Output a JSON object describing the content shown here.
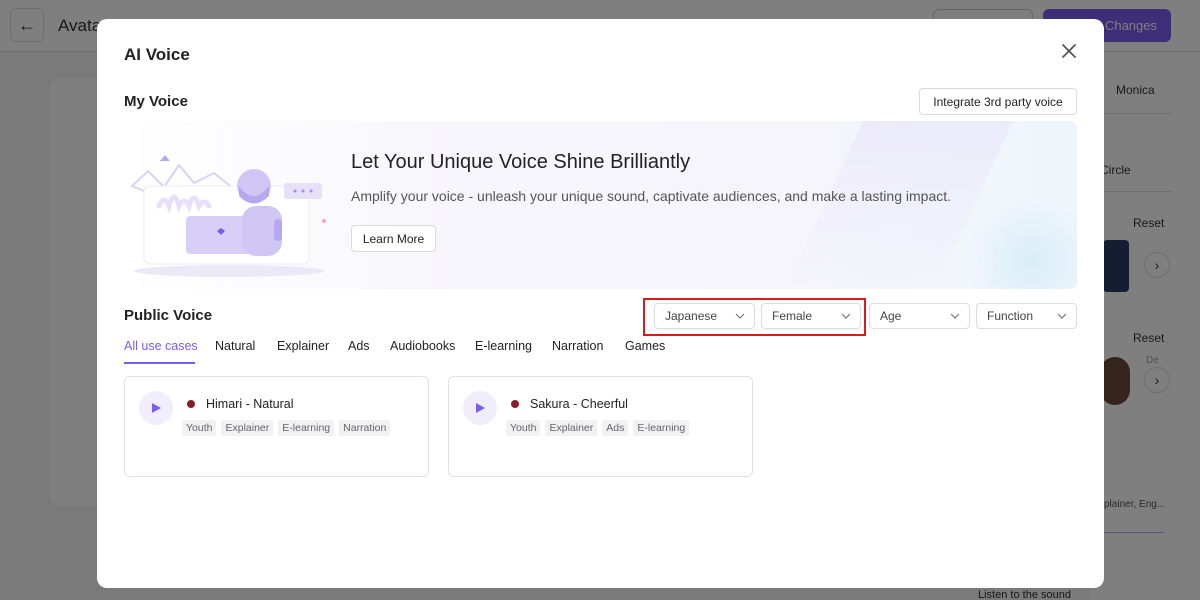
{
  "background": {
    "page_title": "Avata",
    "primary_button_label": "Changes",
    "right_panel": {
      "name": "Monica",
      "circle_label": "Circle",
      "reset_label_1": "Reset",
      "reset_label_2": "Reset",
      "dim_label": "De",
      "voice_tags_label": "plainer, Eng...",
      "listen_label": "Listen to the sound"
    }
  },
  "modal": {
    "title": "AI Voice",
    "my_voice": {
      "title": "My Voice",
      "integrate_label": "Integrate 3rd party voice",
      "banner": {
        "heading": "Let Your Unique Voice Shine Brilliantly",
        "description": "Amplify your voice - unleash your unique sound, captivate audiences, and make a lasting impact.",
        "learn_more_label": "Learn More"
      }
    },
    "public_voice": {
      "title": "Public Voice",
      "filters": [
        {
          "label": "Japanese"
        },
        {
          "label": "Female"
        },
        {
          "label": "Age"
        },
        {
          "label": "Function"
        }
      ],
      "tabs": [
        {
          "label": "All use cases",
          "active": true
        },
        {
          "label": "Natural"
        },
        {
          "label": "Explainer"
        },
        {
          "label": "Ads"
        },
        {
          "label": "Audiobooks"
        },
        {
          "label": "E-learning"
        },
        {
          "label": "Narration"
        },
        {
          "label": "Games"
        }
      ],
      "voices": [
        {
          "name": "Himari - Natural",
          "tags": [
            "Youth",
            "Explainer",
            "E-learning",
            "Narration"
          ]
        },
        {
          "name": "Sakura - Cheerful",
          "tags": [
            "Youth",
            "Explainer",
            "Ads",
            "E-learning"
          ]
        }
      ]
    }
  },
  "colors": {
    "accent": "#7b5cf0",
    "highlight": "#d81b1b",
    "flag": "#8b1a2b"
  }
}
